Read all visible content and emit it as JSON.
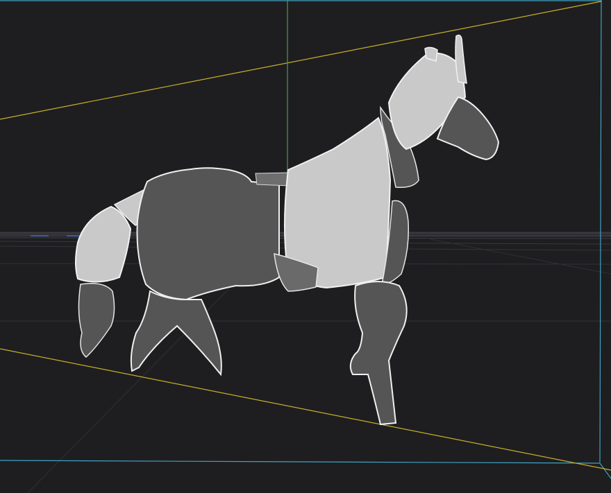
{
  "viewport": {
    "background": "#1e1e20",
    "camera_frame_color": "#3fa3c4",
    "light_guide_color": "#c9b02a",
    "vertical_axis_color": "#4a9c4a",
    "grid_color": "#4a4a50",
    "horizon_band_color": "#3a3a40"
  },
  "model": {
    "name": "horse",
    "light_panel_color": "#c9c9c9",
    "dark_panel_color": "#555555",
    "edge_highlight_color": "#f2f2f2",
    "shadow_color": "#2e2e2e"
  }
}
